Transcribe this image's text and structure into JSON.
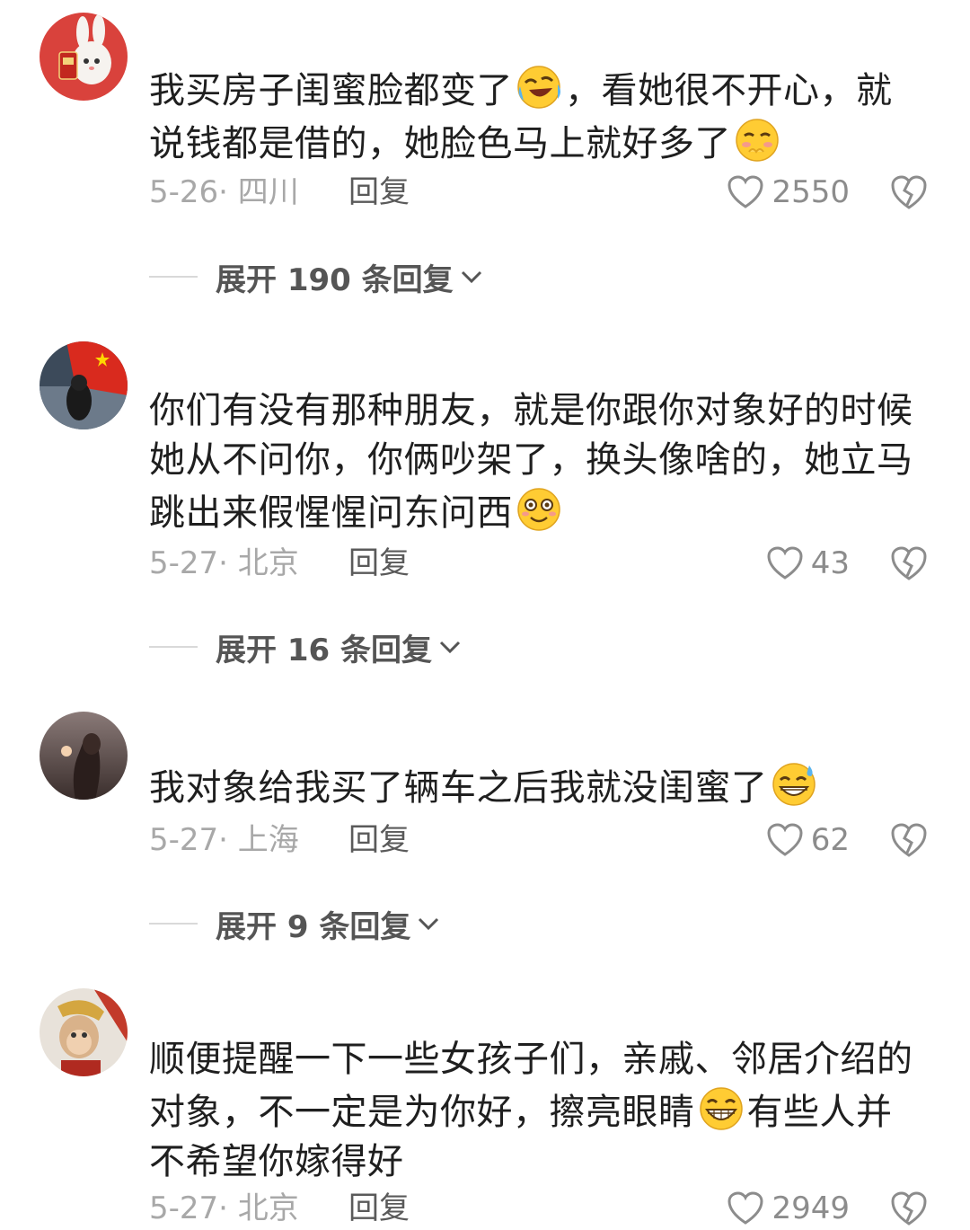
{
  "comments": [
    {
      "text_parts": [
        "我买房子闺蜜脸都变了",
        "，看她很不开心，就说钱都是借的，她脸色马上就好多了"
      ],
      "emoji_after_part": [
        "laughing-crying-emoji",
        "shy-emoji"
      ],
      "date": "5-26· 四川",
      "reply_label": "回复",
      "likes": "2550",
      "expand_label": "展开 190 条回复"
    },
    {
      "text_parts": [
        "你们有没有那种朋友，就是你跟你对象好的时候她从不问你，你俩吵架了，换头像啥的，她立马跳出来假惺惺问东问西"
      ],
      "emoji_after_part": [
        "dizzy-smile-emoji"
      ],
      "date": "5-27· 北京",
      "reply_label": "回复",
      "likes": "43",
      "expand_label": "展开 16 条回复"
    },
    {
      "text_parts": [
        "我对象给我买了辆车之后我就没闺蜜了"
      ],
      "emoji_after_part": [
        "grin-sweat-emoji"
      ],
      "date": "5-27· 上海",
      "reply_label": "回复",
      "likes": "62",
      "expand_label": "展开 9 条回复"
    },
    {
      "text_parts": [
        "顺便提醒一下一些女孩子们，亲戚、邻居介绍的对象，不一定是为你好，擦亮眼睛",
        "有些人并不希望你嫁得好"
      ],
      "emoji_after_part": [
        "big-grin-emoji"
      ],
      "date": "5-27· 北京",
      "reply_label": "回复",
      "likes": "2949"
    }
  ],
  "colors": {
    "text": "#1f1f1f",
    "meta": "#a8a8a8",
    "reply": "#5a5a5a",
    "expand": "#555555",
    "emoji_yellow": "#ffcc33"
  }
}
